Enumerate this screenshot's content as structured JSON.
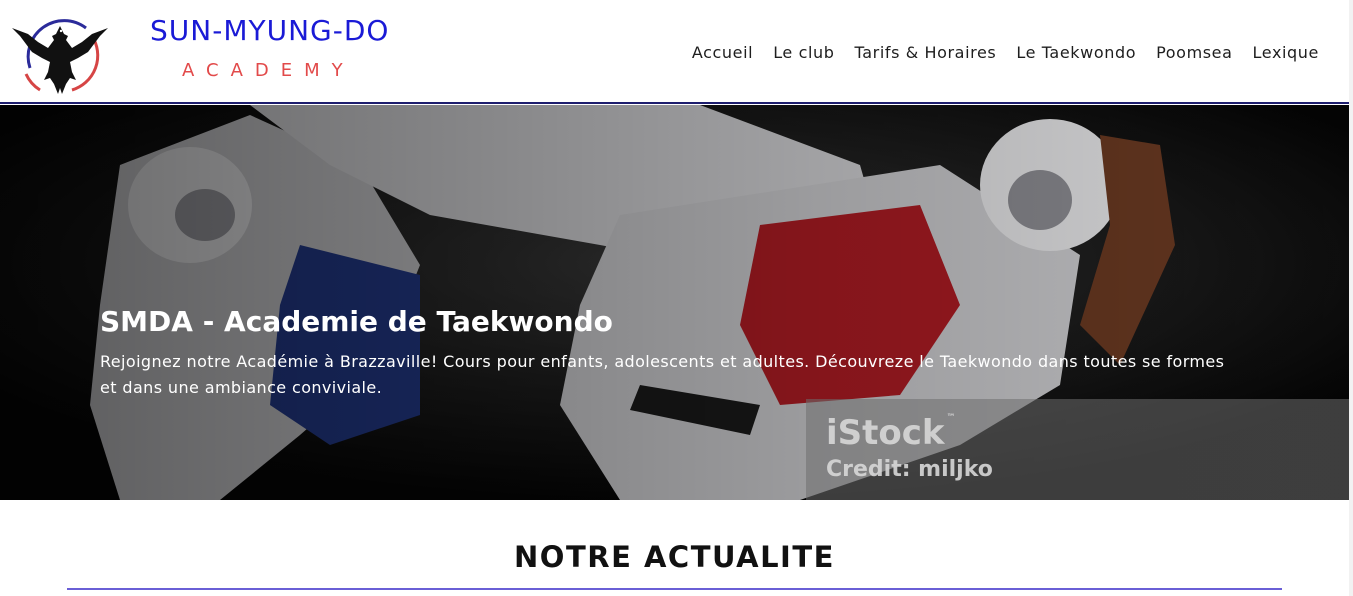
{
  "header": {
    "brand_title": "SUN-MYUNG-DO",
    "brand_subtitle": "ACADEMY",
    "logo_icon": "eagle-emblem-icon",
    "nav": [
      {
        "label": "Accueil"
      },
      {
        "label": "Le club"
      },
      {
        "label": "Tarifs & Horaires"
      },
      {
        "label": "Le Taekwondo"
      },
      {
        "label": "Poomsea"
      },
      {
        "label": "Lexique"
      }
    ]
  },
  "hero": {
    "title": "SMDA - Academie de Taekwondo",
    "text": "Rejoignez notre Académie à Brazzaville! Cours pour enfants, adolescents et adultes. Découvreze le Taekwondo dans toutes se formes et dans une ambiance conviviale.",
    "watermark_brand": "iStock",
    "watermark_tm": "™",
    "watermark_credit": "Credit: miljko"
  },
  "news": {
    "heading": "NOTRE ACTUALITE"
  },
  "colors": {
    "brand_blue": "#1a1ad6",
    "brand_red": "#e24a4a",
    "rule_purple": "#6a5fd6",
    "header_border": "#1d1d6e"
  }
}
